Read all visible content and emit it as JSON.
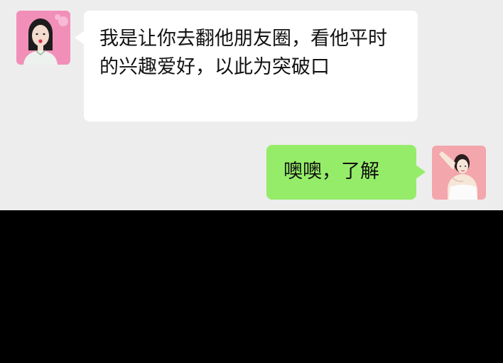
{
  "colors": {
    "chat_background": "#ededed",
    "incoming_bubble": "#ffffff",
    "outgoing_bubble": "#95ec69",
    "text": "#111111",
    "lower_area": "#000000"
  },
  "messages": [
    {
      "direction": "incoming",
      "text": "我是让你去翻他朋友圈，看他平时的兴趣爱好，以此为突破口",
      "avatar_icon": "woman-blowing-bubblegum-avatar"
    },
    {
      "direction": "outgoing",
      "text": "噢噢，了解",
      "avatar_icon": "woman-raising-arm-avatar"
    }
  ]
}
